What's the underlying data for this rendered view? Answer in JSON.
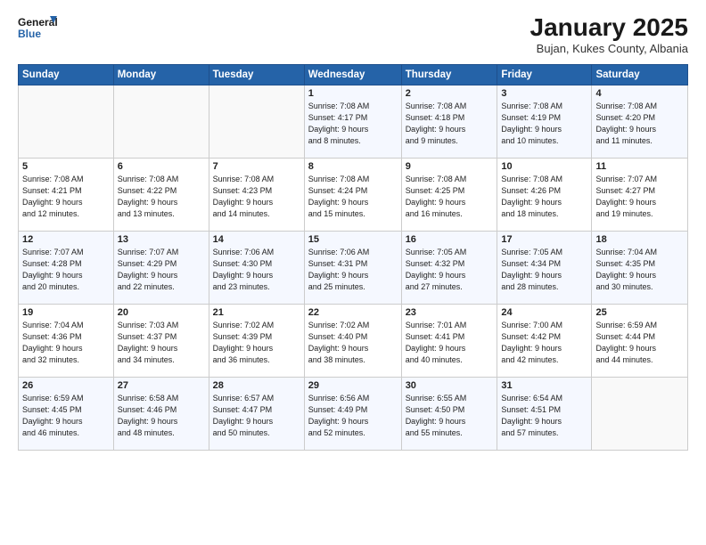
{
  "logo": {
    "general": "General",
    "blue": "Blue"
  },
  "header": {
    "month": "January 2025",
    "location": "Bujan, Kukes County, Albania"
  },
  "weekdays": [
    "Sunday",
    "Monday",
    "Tuesday",
    "Wednesday",
    "Thursday",
    "Friday",
    "Saturday"
  ],
  "weeks": [
    [
      {
        "day": "",
        "info": ""
      },
      {
        "day": "",
        "info": ""
      },
      {
        "day": "",
        "info": ""
      },
      {
        "day": "1",
        "info": "Sunrise: 7:08 AM\nSunset: 4:17 PM\nDaylight: 9 hours\nand 8 minutes."
      },
      {
        "day": "2",
        "info": "Sunrise: 7:08 AM\nSunset: 4:18 PM\nDaylight: 9 hours\nand 9 minutes."
      },
      {
        "day": "3",
        "info": "Sunrise: 7:08 AM\nSunset: 4:19 PM\nDaylight: 9 hours\nand 10 minutes."
      },
      {
        "day": "4",
        "info": "Sunrise: 7:08 AM\nSunset: 4:20 PM\nDaylight: 9 hours\nand 11 minutes."
      }
    ],
    [
      {
        "day": "5",
        "info": "Sunrise: 7:08 AM\nSunset: 4:21 PM\nDaylight: 9 hours\nand 12 minutes."
      },
      {
        "day": "6",
        "info": "Sunrise: 7:08 AM\nSunset: 4:22 PM\nDaylight: 9 hours\nand 13 minutes."
      },
      {
        "day": "7",
        "info": "Sunrise: 7:08 AM\nSunset: 4:23 PM\nDaylight: 9 hours\nand 14 minutes."
      },
      {
        "day": "8",
        "info": "Sunrise: 7:08 AM\nSunset: 4:24 PM\nDaylight: 9 hours\nand 15 minutes."
      },
      {
        "day": "9",
        "info": "Sunrise: 7:08 AM\nSunset: 4:25 PM\nDaylight: 9 hours\nand 16 minutes."
      },
      {
        "day": "10",
        "info": "Sunrise: 7:08 AM\nSunset: 4:26 PM\nDaylight: 9 hours\nand 18 minutes."
      },
      {
        "day": "11",
        "info": "Sunrise: 7:07 AM\nSunset: 4:27 PM\nDaylight: 9 hours\nand 19 minutes."
      }
    ],
    [
      {
        "day": "12",
        "info": "Sunrise: 7:07 AM\nSunset: 4:28 PM\nDaylight: 9 hours\nand 20 minutes."
      },
      {
        "day": "13",
        "info": "Sunrise: 7:07 AM\nSunset: 4:29 PM\nDaylight: 9 hours\nand 22 minutes."
      },
      {
        "day": "14",
        "info": "Sunrise: 7:06 AM\nSunset: 4:30 PM\nDaylight: 9 hours\nand 23 minutes."
      },
      {
        "day": "15",
        "info": "Sunrise: 7:06 AM\nSunset: 4:31 PM\nDaylight: 9 hours\nand 25 minutes."
      },
      {
        "day": "16",
        "info": "Sunrise: 7:05 AM\nSunset: 4:32 PM\nDaylight: 9 hours\nand 27 minutes."
      },
      {
        "day": "17",
        "info": "Sunrise: 7:05 AM\nSunset: 4:34 PM\nDaylight: 9 hours\nand 28 minutes."
      },
      {
        "day": "18",
        "info": "Sunrise: 7:04 AM\nSunset: 4:35 PM\nDaylight: 9 hours\nand 30 minutes."
      }
    ],
    [
      {
        "day": "19",
        "info": "Sunrise: 7:04 AM\nSunset: 4:36 PM\nDaylight: 9 hours\nand 32 minutes."
      },
      {
        "day": "20",
        "info": "Sunrise: 7:03 AM\nSunset: 4:37 PM\nDaylight: 9 hours\nand 34 minutes."
      },
      {
        "day": "21",
        "info": "Sunrise: 7:02 AM\nSunset: 4:39 PM\nDaylight: 9 hours\nand 36 minutes."
      },
      {
        "day": "22",
        "info": "Sunrise: 7:02 AM\nSunset: 4:40 PM\nDaylight: 9 hours\nand 38 minutes."
      },
      {
        "day": "23",
        "info": "Sunrise: 7:01 AM\nSunset: 4:41 PM\nDaylight: 9 hours\nand 40 minutes."
      },
      {
        "day": "24",
        "info": "Sunrise: 7:00 AM\nSunset: 4:42 PM\nDaylight: 9 hours\nand 42 minutes."
      },
      {
        "day": "25",
        "info": "Sunrise: 6:59 AM\nSunset: 4:44 PM\nDaylight: 9 hours\nand 44 minutes."
      }
    ],
    [
      {
        "day": "26",
        "info": "Sunrise: 6:59 AM\nSunset: 4:45 PM\nDaylight: 9 hours\nand 46 minutes."
      },
      {
        "day": "27",
        "info": "Sunrise: 6:58 AM\nSunset: 4:46 PM\nDaylight: 9 hours\nand 48 minutes."
      },
      {
        "day": "28",
        "info": "Sunrise: 6:57 AM\nSunset: 4:47 PM\nDaylight: 9 hours\nand 50 minutes."
      },
      {
        "day": "29",
        "info": "Sunrise: 6:56 AM\nSunset: 4:49 PM\nDaylight: 9 hours\nand 52 minutes."
      },
      {
        "day": "30",
        "info": "Sunrise: 6:55 AM\nSunset: 4:50 PM\nDaylight: 9 hours\nand 55 minutes."
      },
      {
        "day": "31",
        "info": "Sunrise: 6:54 AM\nSunset: 4:51 PM\nDaylight: 9 hours\nand 57 minutes."
      },
      {
        "day": "",
        "info": ""
      }
    ]
  ]
}
